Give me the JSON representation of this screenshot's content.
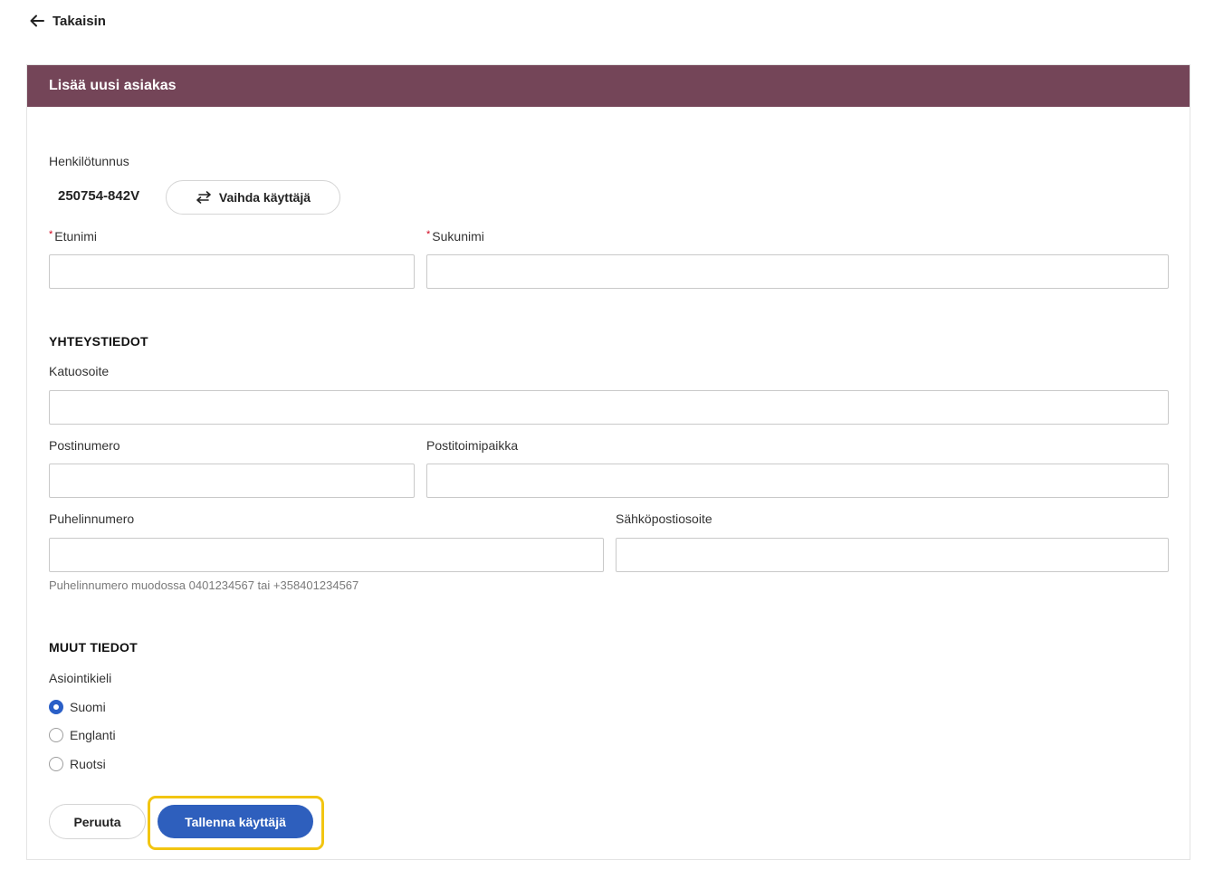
{
  "nav": {
    "back_label": "Takaisin"
  },
  "card": {
    "title": "Lisää uusi asiakas"
  },
  "identity": {
    "ssn_label": "Henkilötunnus",
    "ssn_value": "250754-842V",
    "switch_user_label": "Vaihda käyttäjä"
  },
  "name": {
    "required_marker": "*",
    "first_name_label": "Etunimi",
    "first_name_value": "",
    "last_name_label": "Sukunimi",
    "last_name_value": ""
  },
  "contact": {
    "section_title": "YHTEYSTIEDOT",
    "street_label": "Katuosoite",
    "street_value": "",
    "postal_code_label": "Postinumero",
    "postal_code_value": "",
    "city_label": "Postitoimipaikka",
    "city_value": "",
    "phone_label": "Puhelinnumero",
    "phone_value": "",
    "phone_hint": "Puhelinnumero muodossa 0401234567 tai +358401234567",
    "email_label": "Sähköpostiosoite",
    "email_value": ""
  },
  "other": {
    "section_title": "MUUT TIEDOT",
    "language_label": "Asiointikieli",
    "language_options": [
      {
        "label": "Suomi",
        "checked": true
      },
      {
        "label": "Englanti",
        "checked": false
      },
      {
        "label": "Ruotsi",
        "checked": false
      }
    ]
  },
  "actions": {
    "cancel_label": "Peruuta",
    "save_label": "Tallenna käyttäjä"
  },
  "colors": {
    "header": "#744558",
    "primary": "#2e5fbd",
    "highlight": "#f2c511",
    "required": "#d0021b"
  },
  "icons": {
    "back": "arrow-left-icon",
    "switch": "swap-arrows-icon"
  }
}
